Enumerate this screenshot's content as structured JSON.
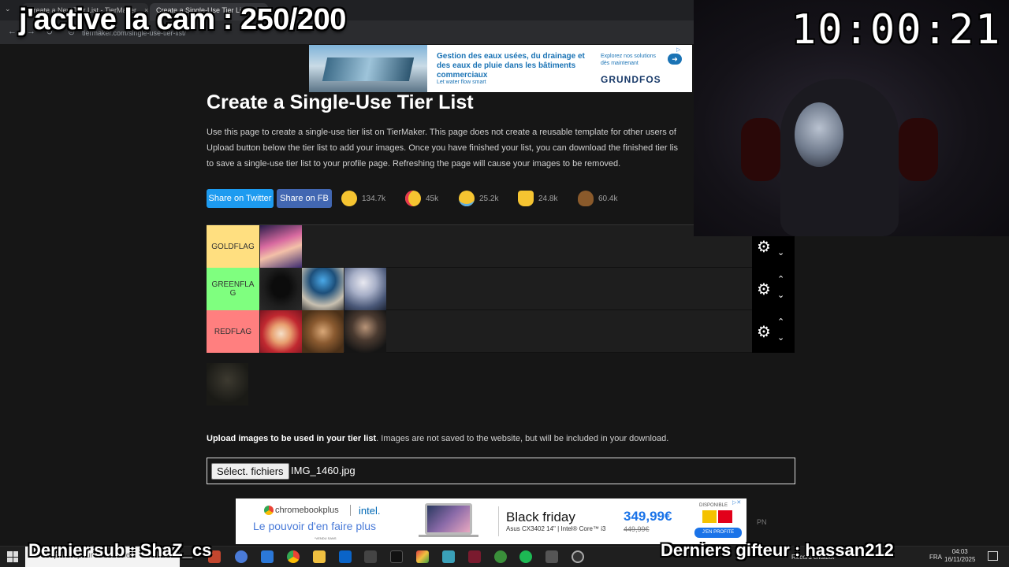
{
  "browser": {
    "tabs": [
      {
        "label": "Create a New Tier List - TierMaker"
      },
      {
        "label": "Create a Single-Use Tier List @"
      }
    ],
    "url": "tiermaker.com/single-use-tier-list/"
  },
  "overlay": {
    "top_text": "j'active la cam : 250/200",
    "timer": "10:00:21",
    "last_sub": "Dernier sub : ShaZ_cs",
    "last_gifter": "Derniers gifteur : hassan212"
  },
  "ad_top": {
    "headline": "Gestion des eaux usées, du drainage et des eaux de pluie dans les bâtiments commerciaux",
    "sub": "Let water flow smart",
    "cta": "Explorez nos solutions dès maintenant",
    "brand": "GRUNDFOS"
  },
  "page": {
    "title": "Create a Single-Use Tier List",
    "desc_lines": [
      "Use this page to create a single-use tier list on TierMaker. This page does not create a reusable template for other users of",
      "Upload button below the tier list to add your images. Once you have finished your list, you can download the finished tier lis",
      "to save a single-use tier list to your profile page. Refreshing the page will cause your images to be removed."
    ],
    "share_twitter": "Share on Twitter",
    "share_fb": "Share on FB",
    "reactions": [
      {
        "icon": "grinning-face-icon",
        "count": "134.7k",
        "color": "#f5c431"
      },
      {
        "icon": "heart-eyes-face-icon",
        "count": "45k",
        "color": "#f5c431"
      },
      {
        "icon": "joy-face-icon",
        "count": "25.2k",
        "color": "#f5c431"
      },
      {
        "icon": "raised-hands-icon",
        "count": "24.8k",
        "color": "#f5c431"
      },
      {
        "icon": "poop-icon",
        "count": "60.4k",
        "color": "#8a5a2b"
      }
    ],
    "tiers": [
      {
        "label": "GOLDFLAG",
        "color": "#ffdf80"
      },
      {
        "label": "GREENFLAG",
        "color": "#7fff7f"
      },
      {
        "label": "REDFLAG",
        "color": "#ff7f7f"
      }
    ],
    "upload_bold": "Upload images to be used in your tier list",
    "upload_rest": ". Images are not saved to the website, but will be included in your download.",
    "file_button": "Sélect. fichiers",
    "file_name": "IMG_1460.jpg"
  },
  "ad_bottom": {
    "chromebook": "chromebookplus",
    "intel": "intel.",
    "tagline": "Le pouvoir d'en faire plus",
    "vendu": "*VENDU SANS",
    "headline": "Black friday",
    "model": "Asus CX3402 14\" | Intel® Core™ i3",
    "price": "349,99€",
    "old_price": "449,99€",
    "dispo": "DISPONIBLE",
    "cta": "J'EN PROFITE"
  },
  "side_text": "PN",
  "taskbar": {
    "search_placeholder": "Taper ici pour rechercher",
    "rec_label": "Record chatbot",
    "lang": "FRA",
    "time": "04:03",
    "date": "16/11/2025"
  }
}
